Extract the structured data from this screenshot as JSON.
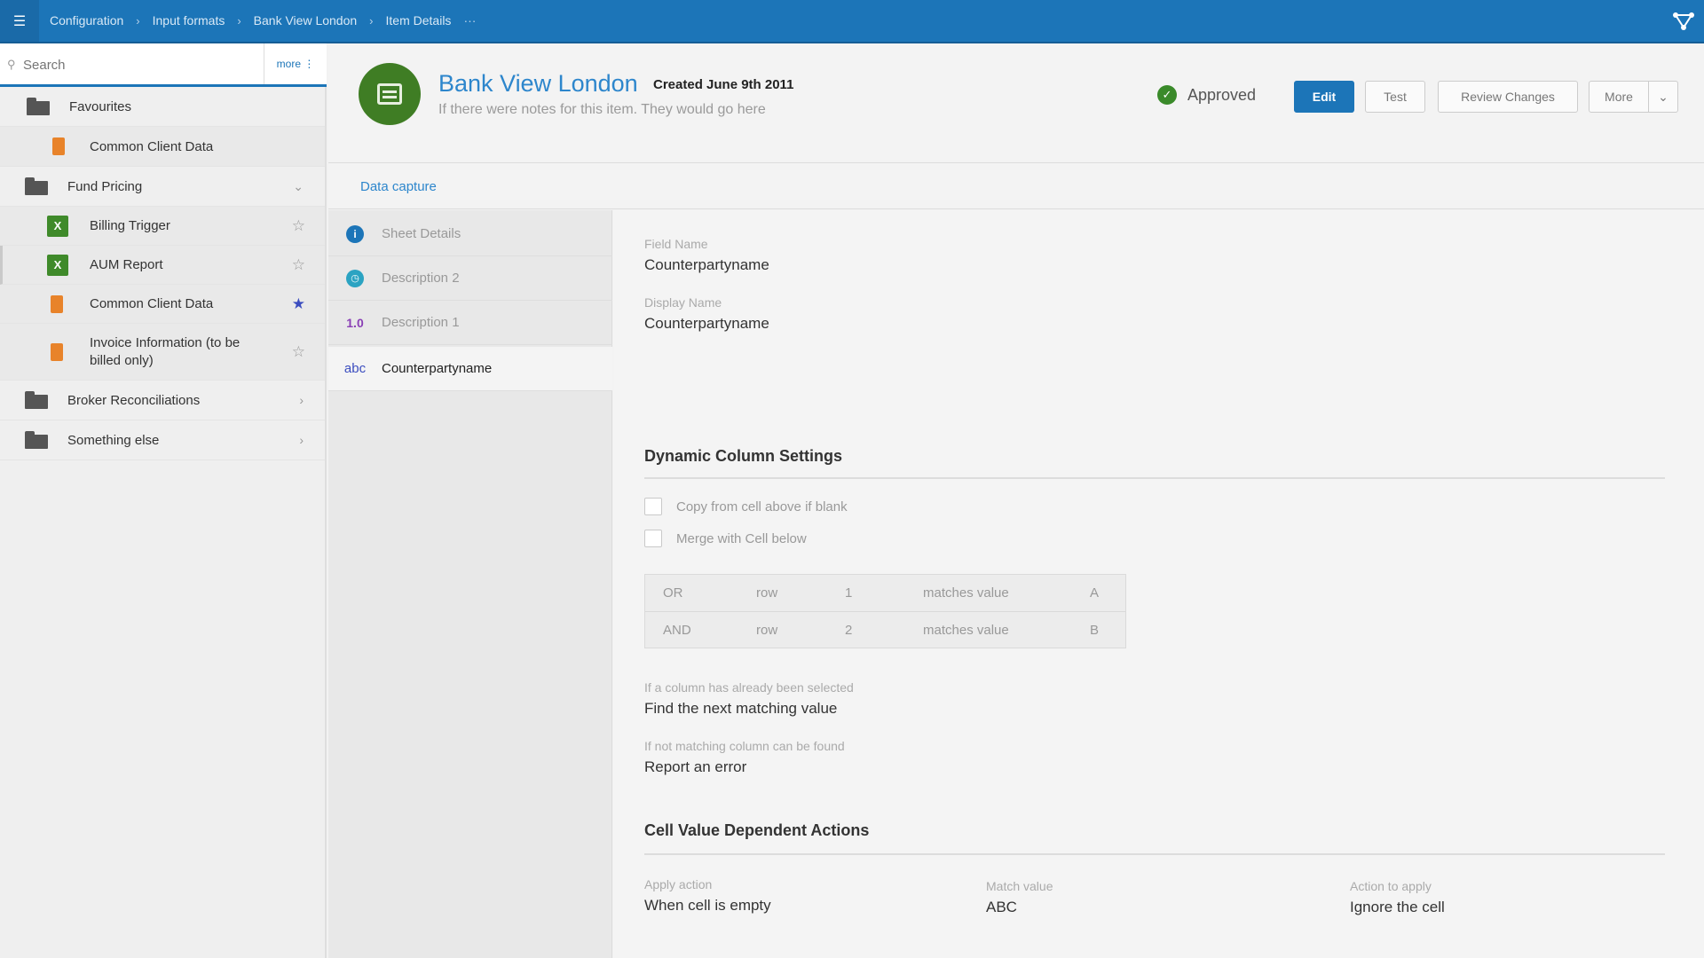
{
  "topbar": {
    "breadcrumbs": [
      "Configuration",
      "Input formats",
      "Bank View London",
      "Item Details"
    ],
    "more": "···"
  },
  "sidebar": {
    "search_placeholder": "Search",
    "more_label": "more",
    "items": [
      {
        "label": "Favourites",
        "kind": "folder"
      },
      {
        "label": "Common Client Data",
        "kind": "doc"
      },
      {
        "label": "Fund Pricing",
        "kind": "folder",
        "chevron": "down"
      },
      {
        "label": "Billing Trigger",
        "kind": "excel",
        "icon_letter": "X",
        "starred": false
      },
      {
        "label": "AUM Report",
        "kind": "excel",
        "icon_letter": "X",
        "starred": false
      },
      {
        "label": "Common Client Data",
        "kind": "doc",
        "starred": true
      },
      {
        "label": "Invoice Information (to be billed only)",
        "kind": "doc",
        "starred": false
      },
      {
        "label": "Broker Reconciliations",
        "kind": "folder",
        "chevron": "right"
      },
      {
        "label": "Something else",
        "kind": "folder",
        "chevron": "right"
      }
    ]
  },
  "header": {
    "title": "Bank View London",
    "created": "Created June 9th 2011",
    "notes": "If there were notes for this item. They would go here",
    "status": "Approved",
    "buttons": {
      "edit": "Edit",
      "test": "Test",
      "review": "Review Changes",
      "more": "More"
    }
  },
  "tabs": [
    "Data capture"
  ],
  "sections": [
    {
      "label": "Sheet Details",
      "icon": "info-icon"
    },
    {
      "label": "Description 2",
      "icon": "clock-icon"
    },
    {
      "label": "Description 1",
      "icon": "number-icon",
      "glyph": "1.0"
    },
    {
      "label": "Counterpartyname",
      "icon": "text-icon",
      "glyph": "abc",
      "active": true
    }
  ],
  "detail": {
    "field_name_label": "Field Name",
    "field_name": "Counterpartyname",
    "display_name_label": "Display Name",
    "display_name": "Counterpartyname",
    "dynamic_title": "Dynamic Column Settings",
    "checkbox_copy": "Copy from cell above if blank",
    "checkbox_merge": "Merge with Cell below",
    "rules": [
      {
        "op": "OR",
        "target": "row",
        "num": "1",
        "cond": "matches value",
        "val": "A"
      },
      {
        "op": "AND",
        "target": "row",
        "num": "2",
        "cond": "matches value",
        "val": "B"
      }
    ],
    "already_selected_label": "If a column has already been selected",
    "already_selected_value": "Find the next matching value",
    "no_match_label": "If not matching column can be found",
    "no_match_value": "Report an error",
    "cell_actions_title": "Cell Value Dependent Actions",
    "apply_action_label": "Apply action",
    "apply_action_value": "When cell is empty",
    "match_value_label": "Match value",
    "match_value_value": "ABC",
    "action_to_apply_label": "Action to apply",
    "action_to_apply_value": "Ignore the cell"
  }
}
